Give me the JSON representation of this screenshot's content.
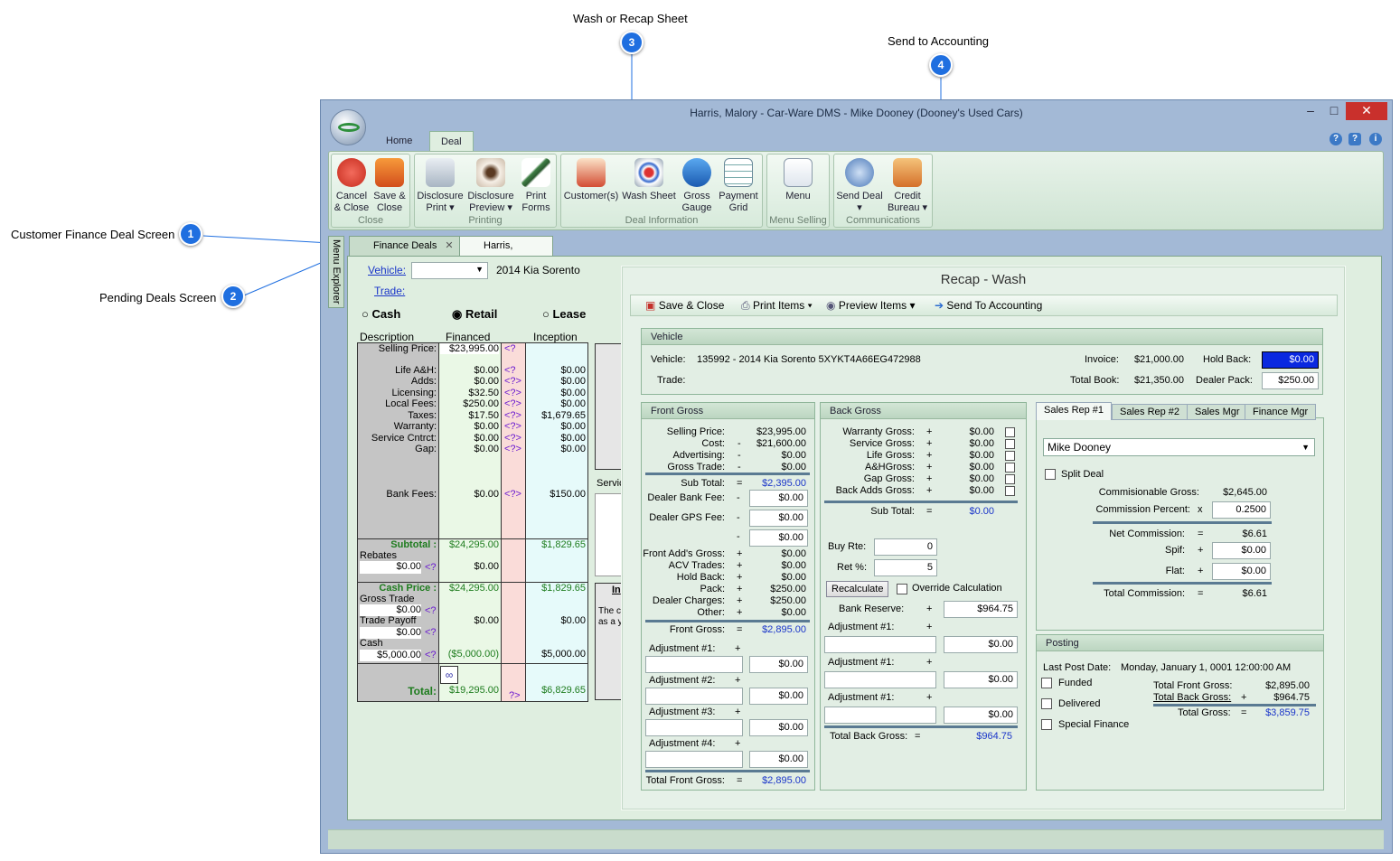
{
  "callouts": {
    "c1": "1",
    "c2": "2",
    "c3": "3",
    "c4": "4",
    "l1": "Customer Finance Deal Screen",
    "l2": "Pending Deals Screen",
    "l3": "Wash or Recap Sheet",
    "l4": "Send to Accounting"
  },
  "window": {
    "title": "Harris, Malory  - Car-Ware DMS - Mike Dooney  (Dooney's Used Cars)",
    "min": "–",
    "max": "□",
    "close": "✕"
  },
  "ribbon_tabs": [
    "Home",
    "Deal"
  ],
  "ribbon": {
    "cancel": "Cancel",
    "cancel2": "& Close",
    "save": "Save &",
    "save2": "Close",
    "g_close": "Close",
    "disc_print": "Disclosure",
    "disc_print2": "Print ▾",
    "disc_prev": "Disclosure",
    "disc_prev2": "Preview ▾",
    "print_forms": "Print",
    "print_forms2": "Forms",
    "g_printing": "Printing",
    "customers": "Customer(s)",
    "wash": "Wash Sheet",
    "gross": "Gross",
    "gross2": "Gauge",
    "payment": "Payment",
    "payment2": "Grid",
    "g_deal": "Deal Information",
    "menu": "Menu",
    "g_menu": "Menu Selling",
    "send_deal": "Send Deal",
    "send_deal2": "▾",
    "credit": "Credit",
    "credit2": "Bureau ▾",
    "g_comm": "Communications"
  },
  "doc_tabs": {
    "side": "Menu Explorer",
    "finance": "Finance Deals",
    "harris": "Harris, Malory"
  },
  "deal": {
    "vehicle_lbl": "Vehicle:",
    "vehicle_val": "2014 Kia Sorento",
    "trade_lbl": "Trade:",
    "cash": "Cash",
    "retail": "Retail",
    "lease": "Lease",
    "h_desc": "Description",
    "h_fin": "Financed",
    "h_inc": "Inception",
    "rows": [
      [
        "Selling Price:",
        "$23,995.00",
        "<?",
        ""
      ],
      [
        "Life A&H:",
        "$0.00",
        "<?",
        "$0.00"
      ],
      [
        "Adds:",
        "$0.00",
        "<?>",
        "$0.00"
      ],
      [
        "Licensing:",
        "$32.50",
        "<?>",
        "$0.00"
      ],
      [
        "Local Fees:",
        "$250.00",
        "<?>",
        "$0.00"
      ],
      [
        "Taxes:",
        "$17.50",
        "<?>",
        "$1,679.65"
      ],
      [
        "Warranty:",
        "$0.00",
        "<?>",
        "$0.00"
      ],
      [
        "Service Cntrct:",
        "$0.00",
        "<?>",
        "$0.00"
      ],
      [
        "Gap:",
        "$0.00",
        "<?>",
        "$0.00"
      ]
    ],
    "bank_fees": "Bank Fees:",
    "bank_fin": "$0.00",
    "bank_q": "<?>",
    "bank_inc": "$150.00",
    "subtotal": "Subtotal :",
    "sub_fin": "$24,295.00",
    "sub_inc": "$1,829.65",
    "rebates": "Rebates",
    "reb_val": "$0.00",
    "reb_q": "<?",
    "reb_fin": "$0.00",
    "cash_price": "Cash Price :",
    "cp_fin": "$24,295.00",
    "cp_inc": "$1,829.65",
    "gross_trade": "Gross Trade",
    "gt_val": "$0.00",
    "gt_q": "<?",
    "trade_payoff": "Trade Payoff",
    "tp_val": "$0.00",
    "tp_q": "<?",
    "tp_fin": "$0.00",
    "tp_inc": "$0.00",
    "cash_lbl": "Cash",
    "cash_val": "$5,000.00",
    "cash_q": "<?",
    "cash_fin": "($5,000.00)",
    "cash_inc": "$5,000.00",
    "total": "Total:",
    "tot_fin": "$19,295.00",
    "tot_q": "?>",
    "tot_inc": "$6,829.65",
    "servic": "Servic",
    "in_lbl": "In",
    "the_c": "The c",
    "as_a": "as a y"
  },
  "recap": {
    "title": "Recap - Wash",
    "tb_save": "Save & Close",
    "tb_print": "Print Items ▾",
    "tb_preview": "Preview Items ▾",
    "tb_send": "Send To Accounting",
    "veh_head": "Vehicle",
    "veh_lbl": "Vehicle:",
    "veh_val": "135992 - 2014 Kia Sorento 5XYKT4A66EG472988",
    "trade_lbl": "Trade:",
    "invoice_lbl": "Invoice:",
    "invoice": "$21,000.00",
    "holdback_lbl": "Hold Back:",
    "holdback": "$0.00",
    "totbook_lbl": "Total Book:",
    "totbook": "$21,350.00",
    "dealerpack_lbl": "Dealer Pack:",
    "dealerpack": "$250.00",
    "fg_head": "Front Gross",
    "fg_rows": [
      [
        "Selling Price:",
        "",
        "$23,995.00"
      ],
      [
        "Cost:",
        "-",
        "$21,600.00"
      ],
      [
        "Advertising:",
        "-",
        "$0.00"
      ],
      [
        "Gross Trade:",
        "-",
        "$0.00"
      ]
    ],
    "fg_sub": "Sub Total:",
    "fg_sub_op": "=",
    "fg_sub_val": "$2,395.00",
    "dbf": "Dealer Bank Fee:",
    "dbf_op": "-",
    "dbf_val": "$0.00",
    "dgps": "Dealer GPS Fee:",
    "dgps_op": "-",
    "dgps_val": "$0.00",
    "blank_op": "-",
    "blank_val": "$0.00",
    "fg_rows2": [
      [
        "Front Add's Gross:",
        "+",
        "$0.00"
      ],
      [
        "ACV Trades:",
        "+",
        "$0.00"
      ],
      [
        "Hold Back:",
        "+",
        "$0.00"
      ],
      [
        "Pack:",
        "+",
        "$250.00"
      ],
      [
        "Dealer Charges:",
        "+",
        "$250.00"
      ],
      [
        "Other:",
        "+",
        "$0.00"
      ]
    ],
    "fg_front": "Front Gross:",
    "fg_front_op": "=",
    "fg_front_val": "$2,895.00",
    "adj1": "Adjustment #1:",
    "adj2": "Adjustment #2:",
    "adj3": "Adjustment #3:",
    "adj4": "Adjustment #4:",
    "plus": "+",
    "zero": "$0.00",
    "fg_total": "Total Front Gross:",
    "fg_total_op": "=",
    "fg_total_val": "$2,895.00",
    "bg_head": "Back Gross",
    "bg_rows": [
      [
        "Warranty Gross:",
        "+",
        "$0.00"
      ],
      [
        "Service Gross:",
        "+",
        "$0.00"
      ],
      [
        "Life Gross:",
        "+",
        "$0.00"
      ],
      [
        "A&HGross:",
        "+",
        "$0.00"
      ],
      [
        "Gap Gross:",
        "+",
        "$0.00"
      ],
      [
        "Back Adds Gross:",
        "+",
        "$0.00"
      ]
    ],
    "bg_sub": "Sub Total:",
    "bg_sub_op": "=",
    "bg_sub_val": "$0.00",
    "buy_rte": "Buy Rte:",
    "buy_val": "0",
    "ret": "Ret %:",
    "ret_val": "5",
    "recalc": "Recalculate",
    "override": "Override Calculation",
    "bank_res": "Bank Reserve:",
    "bank_res_op": "+",
    "bank_res_val": "$964.75",
    "bg_total": "Total Back Gross:",
    "bg_total_op": "=",
    "bg_total_val": "$964.75",
    "s_tabs": [
      "Sales Rep #1",
      "Sales Rep #2",
      "Sales Mgr",
      "Finance Mgr"
    ],
    "rep": "Mike Dooney",
    "split": "Split Deal",
    "comm_gross": "Commisionable Gross:",
    "comm_gross_val": "$2,645.00",
    "comm_pct": "Commission Percent:",
    "comm_pct_op": "x",
    "comm_pct_val": "0.2500",
    "net_comm": "Net Commission:",
    "net_comm_op": "=",
    "net_comm_val": "$6.61",
    "spif": "Spif:",
    "spif_val": "$0.00",
    "flat": "Flat:",
    "flat_val": "$0.00",
    "tot_comm": "Total Commission:",
    "tot_comm_op": "=",
    "tot_comm_val": "$6.61",
    "post_head": "Posting",
    "last_post": "Last Post Date:",
    "last_post_val": "Monday, January 1, 0001 12:00:00 AM",
    "funded": "Funded",
    "delivered": "Delivered",
    "special": "Special Finance",
    "tfg": "Total Front Gross:",
    "tfg_val": "$2,895.00",
    "tbg": "Total Back Gross:",
    "tbg_op": "+",
    "tbg_val": "$964.75",
    "tg": "Total Gross:",
    "tg_op": "=",
    "tg_val": "$3,859.75"
  }
}
